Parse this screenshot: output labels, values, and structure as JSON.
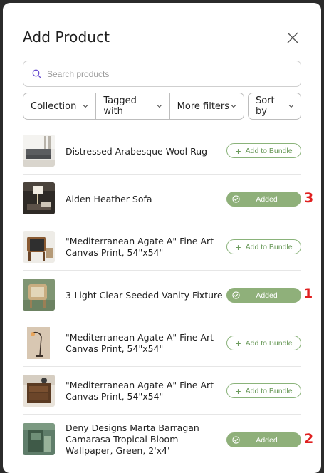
{
  "dialog": {
    "title": "Add Product"
  },
  "search": {
    "placeholder": "Search products"
  },
  "filters": {
    "collection": "Collection",
    "tagged_with": "Tagged with",
    "more_filters": "More filters",
    "sort_by": "Sort by"
  },
  "buttons": {
    "add_label": "Add to Bundle",
    "added_label": "Added"
  },
  "products": [
    {
      "name": "Distressed Arabesque Wool Rug",
      "status": "add"
    },
    {
      "name": "Aiden Heather Sofa",
      "status": "added",
      "badge": "3"
    },
    {
      "name": "\"Mediterranean Agate A\" Fine Art Canvas Print, 54\"x54\"",
      "status": "add"
    },
    {
      "name": "3-Light Clear Seeded Vanity Fixture",
      "status": "added",
      "badge": "1"
    },
    {
      "name": "\"Mediterranean Agate A\" Fine Art Canvas Print, 54\"x54\"",
      "status": "add"
    },
    {
      "name": "\"Mediterranean Agate A\" Fine Art Canvas Print, 54\"x54\"",
      "status": "add"
    },
    {
      "name": "Deny Designs Marta Barragan Camarasa Tropical Bloom Wallpaper, Green, 2'x4'",
      "status": "added",
      "badge": "2"
    }
  ],
  "colors": {
    "added_bg": "#8fb07a",
    "add_border": "#8ab37a",
    "badge_red": "#e02020"
  }
}
